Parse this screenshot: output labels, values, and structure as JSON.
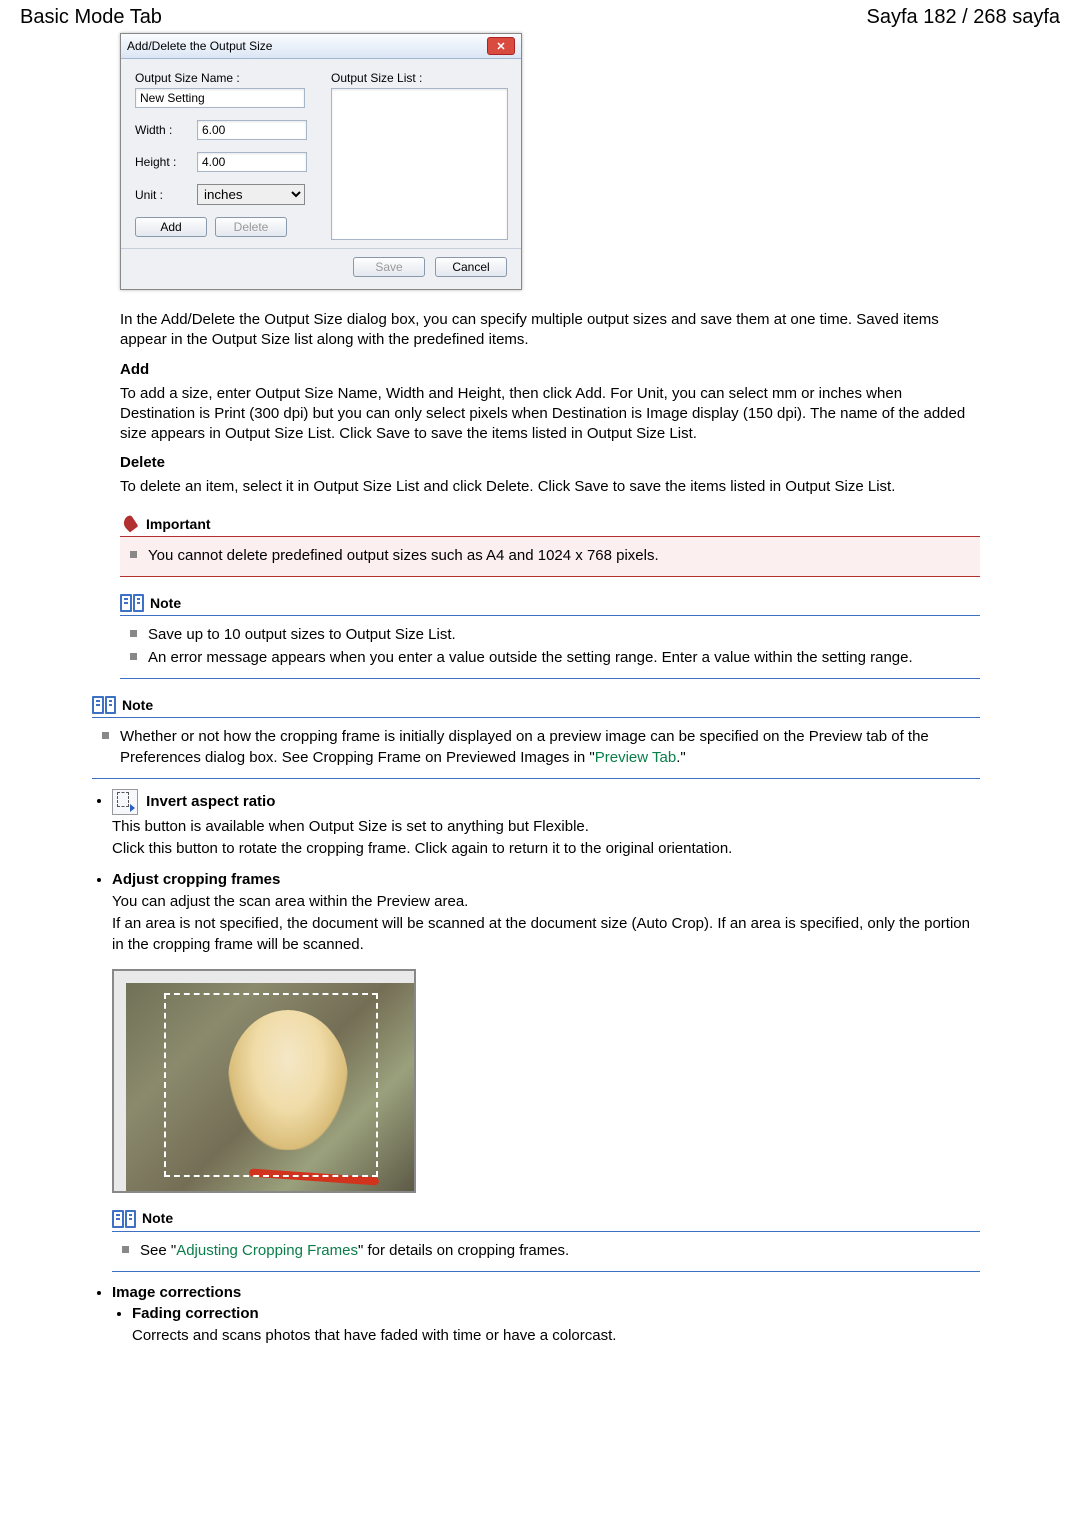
{
  "header": {
    "left": "Basic Mode Tab",
    "right": "Sayfa 182 / 268 sayfa"
  },
  "dialog": {
    "title": "Add/Delete the Output Size",
    "output_size_name_label": "Output Size Name :",
    "output_size_name_value": "New Setting",
    "width_label": "Width :",
    "width_value": "6.00",
    "height_label": "Height :",
    "height_value": "4.00",
    "unit_label": "Unit :",
    "unit_value": "inches",
    "output_size_list_label": "Output Size List :",
    "add_btn": "Add",
    "delete_btn": "Delete",
    "save_btn": "Save",
    "cancel_btn": "Cancel"
  },
  "intro_para": "In the Add/Delete the Output Size dialog box, you can specify multiple output sizes and save them at one time. Saved items appear in the Output Size list along with the predefined items.",
  "add_heading": "Add",
  "add_para": "To add a size, enter Output Size Name, Width and Height, then click Add. For Unit, you can select mm or inches when Destination is Print (300 dpi) but you can only select pixels when Destination is Image display (150 dpi). The name of the added size appears in Output Size List. Click Save to save the items listed in Output Size List.",
  "delete_heading": "Delete",
  "delete_para": "To delete an item, select it in Output Size List and click Delete. Click Save to save the items listed in Output Size List.",
  "important_title": "Important",
  "important_item": "You cannot delete predefined output sizes such as A4 and 1024 x 768 pixels.",
  "note_title": "Note",
  "note1_item1": "Save up to 10 output sizes to Output Size List.",
  "note1_item2": "An error message appears when you enter a value outside the setting range. Enter a value within the setting range.",
  "note2_prefix": "Whether or not how the cropping frame is initially displayed on a preview image can be specified on the Preview tab of the Preferences dialog box. See Cropping Frame on Previewed Images in \"",
  "note2_link": "Preview Tab",
  "note2_suffix": ".\"",
  "invert_heading": "Invert aspect ratio",
  "invert_p1": "This button is available when Output Size is set to anything but Flexible.",
  "invert_p2": "Click this button to rotate the cropping frame. Click again to return it to the original orientation.",
  "adjust_heading": "Adjust cropping frames",
  "adjust_p1": "You can adjust the scan area within the Preview area.",
  "adjust_p2": "If an area is not specified, the document will be scanned at the document size (Auto Crop). If an area is specified, only the portion in the cropping frame will be scanned.",
  "note3_prefix": "See \"",
  "note3_link": "Adjusting Cropping Frames",
  "note3_suffix": "\" for details on cropping frames.",
  "imgcorr_heading": "Image corrections",
  "fading_heading": "Fading correction",
  "fading_para": "Corrects and scans photos that have faded with time or have a colorcast."
}
